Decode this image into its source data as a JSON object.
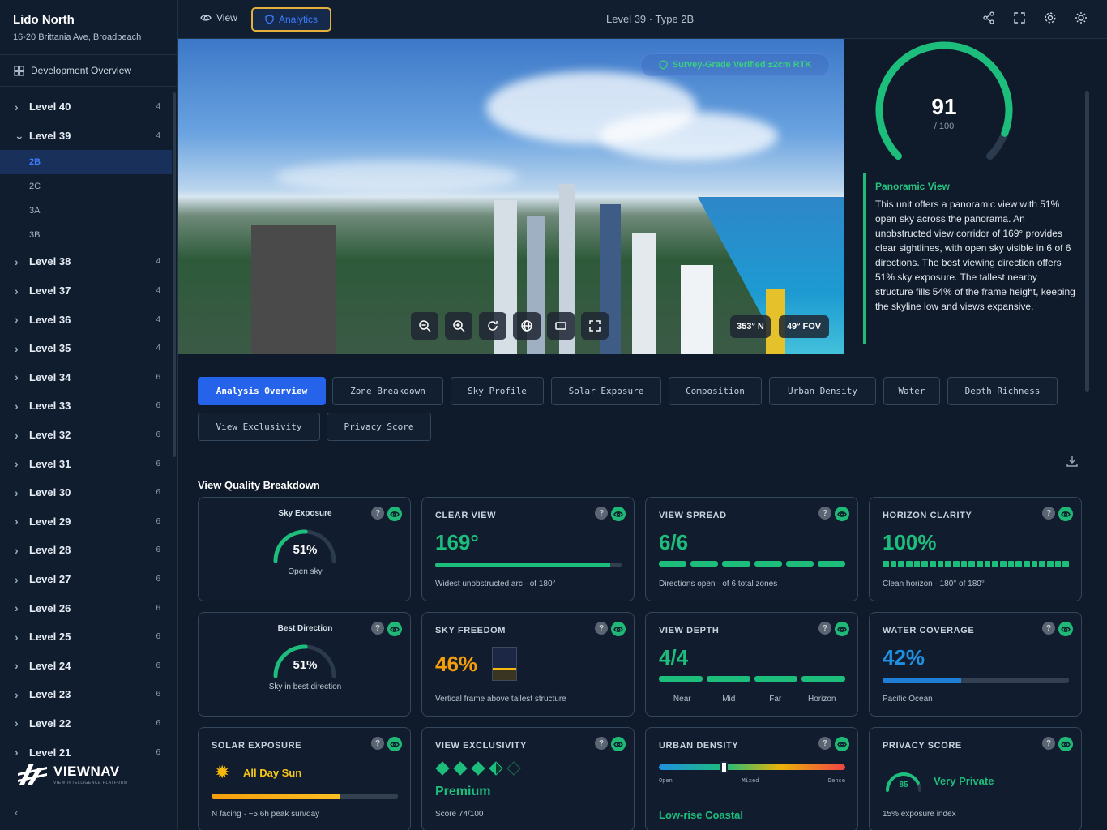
{
  "project": {
    "name": "Lido North",
    "address": "16-20 Brittania Ave, Broadbeach"
  },
  "nav": {
    "overview": "Development Overview"
  },
  "levels": [
    {
      "label": "Level 40",
      "count": "4",
      "expanded": false
    },
    {
      "label": "Level 39",
      "count": "4",
      "expanded": true,
      "units": [
        "2B",
        "2C",
        "3A",
        "3B"
      ],
      "active_unit": "2B"
    },
    {
      "label": "Level 38",
      "count": "4",
      "expanded": false
    },
    {
      "label": "Level 37",
      "count": "4",
      "expanded": false
    },
    {
      "label": "Level 36",
      "count": "4",
      "expanded": false
    },
    {
      "label": "Level 35",
      "count": "4",
      "expanded": false
    },
    {
      "label": "Level 34",
      "count": "6",
      "expanded": false
    },
    {
      "label": "Level 33",
      "count": "6",
      "expanded": false
    },
    {
      "label": "Level 32",
      "count": "6",
      "expanded": false
    },
    {
      "label": "Level 31",
      "count": "6",
      "expanded": false
    },
    {
      "label": "Level 30",
      "count": "6",
      "expanded": false
    },
    {
      "label": "Level 29",
      "count": "6",
      "expanded": false
    },
    {
      "label": "Level 28",
      "count": "6",
      "expanded": false
    },
    {
      "label": "Level 27",
      "count": "6",
      "expanded": false
    },
    {
      "label": "Level 26",
      "count": "6",
      "expanded": false
    },
    {
      "label": "Level 25",
      "count": "6",
      "expanded": false
    },
    {
      "label": "Level 24",
      "count": "6",
      "expanded": false
    },
    {
      "label": "Level 23",
      "count": "6",
      "expanded": false
    },
    {
      "label": "Level 22",
      "count": "6",
      "expanded": false
    },
    {
      "label": "Level 21",
      "count": "6",
      "expanded": false
    }
  ],
  "brand": {
    "name": "VIEWNAV",
    "tagline": "VIEW INTELLIGENCE PLATFORM"
  },
  "topbar": {
    "view_label": "View",
    "analytics_label": "Analytics",
    "title": "Level 39 · Type 2B",
    "icons": [
      "share-icon",
      "fullscreen-icon",
      "gear-icon",
      "sun-icon"
    ]
  },
  "photo": {
    "verified": "Survey-Grade Verified ±2cm RTK",
    "heading": "353° N",
    "fov": "49° FOV",
    "controls": [
      "zoom-out-icon",
      "zoom-in-icon",
      "rotate-icon",
      "globe-icon",
      "frame-icon",
      "expand-icon"
    ]
  },
  "score": {
    "value": "91",
    "denominator": "/ 100",
    "fraction": 0.91,
    "insight_title": "Panoramic View",
    "insight_text": "This unit offers a panoramic view with 51% open sky across the panorama. An unobstructed view corridor of 169° provides clear sightlines, with open sky visible in 6 of 6 directions. The best viewing direction offers 51% sky exposure. The tallest nearby structure fills 54% of the frame height, keeping the skyline low and views expansive."
  },
  "tabs": [
    "Analysis Overview",
    "Zone Breakdown",
    "Sky Profile",
    "Solar Exposure",
    "Composition",
    "Urban Density",
    "Water",
    "Depth Richness",
    "View Exclusivity",
    "Privacy Score"
  ],
  "active_tab": "Analysis Overview",
  "section_title": "View Quality Breakdown",
  "colors": {
    "green": "#1dbd7c",
    "orange": "#f59e0b",
    "blue": "#1f8fe0",
    "accent": "#2563eb"
  },
  "cards": {
    "sky_exposure": {
      "title": "Sky Exposure",
      "value": "51%",
      "sub": "Open sky",
      "fraction": 0.51
    },
    "clear_view": {
      "title": "CLEAR VIEW",
      "value": "169°",
      "sub": "Widest unobstructed arc · of 180°",
      "fraction": 0.939
    },
    "view_spread": {
      "title": "VIEW SPREAD",
      "value": "6/6",
      "sub": "Directions open · of 6 total zones",
      "segments": 6
    },
    "horizon_clarity": {
      "title": "HORIZON CLARITY",
      "value": "100%",
      "sub": "Clean horizon · 180° of 180°",
      "fraction": 1
    },
    "best_direction": {
      "title": "Best Direction",
      "value": "51%",
      "sub": "Sky in best direction",
      "fraction": 0.51
    },
    "sky_freedom": {
      "title": "SKY FREEDOM",
      "value": "46%",
      "sub": "Vertical frame above tallest structure",
      "fraction": 0.46
    },
    "view_depth": {
      "title": "VIEW DEPTH",
      "value": "4/4",
      "labels": [
        "Near",
        "Mid",
        "Far",
        "Horizon"
      ]
    },
    "water_coverage": {
      "title": "WATER COVERAGE",
      "value": "42%",
      "sub": "Pacific Ocean",
      "fraction": 0.42
    },
    "solar_exposure": {
      "title": "SOLAR EXPOSURE",
      "value": "All Day Sun",
      "sub": "N facing · ~5.6h peak sun/day",
      "fraction": 0.69
    },
    "view_exclusivity": {
      "title": "VIEW EXCLUSIVITY",
      "value": "Premium",
      "sub": "Score 74/100",
      "diamonds": 3.5
    },
    "urban_density": {
      "title": "URBAN DENSITY",
      "value": "Low-rise Coastal",
      "scale": [
        "Open",
        "Mixed",
        "Dense"
      ],
      "fraction": 0.35
    },
    "privacy_score": {
      "title": "PRIVACY SCORE",
      "value": "Very Private",
      "score": "85",
      "sub": "15% exposure index",
      "fraction": 0.85
    }
  }
}
